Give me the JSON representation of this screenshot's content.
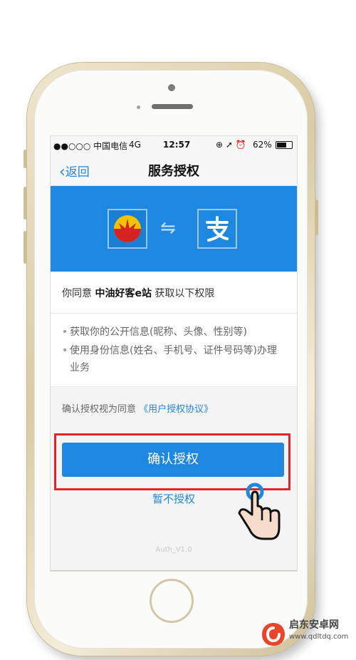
{
  "statusbar": {
    "carrier": "●●○○○ 中国电信",
    "network": "4G",
    "time": "12:57",
    "indicators": "⊕ ➚ ⏰",
    "battery": "62%"
  },
  "nav": {
    "back_label": "返回",
    "title": "服务授权"
  },
  "banner": {
    "swap_icon": "⇋"
  },
  "agreement": {
    "prefix": "你同意",
    "app_name": "中油好客e站",
    "suffix": "获取以下权限"
  },
  "permissions": [
    {
      "text": "获取你的公开信息(昵称、头像、性别等)"
    },
    {
      "text": "使用身份信息(姓名、手机号、证件号码等)办理业务"
    }
  ],
  "protocol": {
    "prefix": "确认授权视为同意",
    "link": "《用户授权协议》"
  },
  "actions": {
    "confirm_label": "确认授权",
    "decline_label": "暂不授权"
  },
  "version": "Auth_V1.0",
  "watermark": {
    "name": "启东安卓网",
    "url": "www.qdltdq.com"
  },
  "colors": {
    "accent": "#1e88e0",
    "highlight": "#e0262b"
  }
}
